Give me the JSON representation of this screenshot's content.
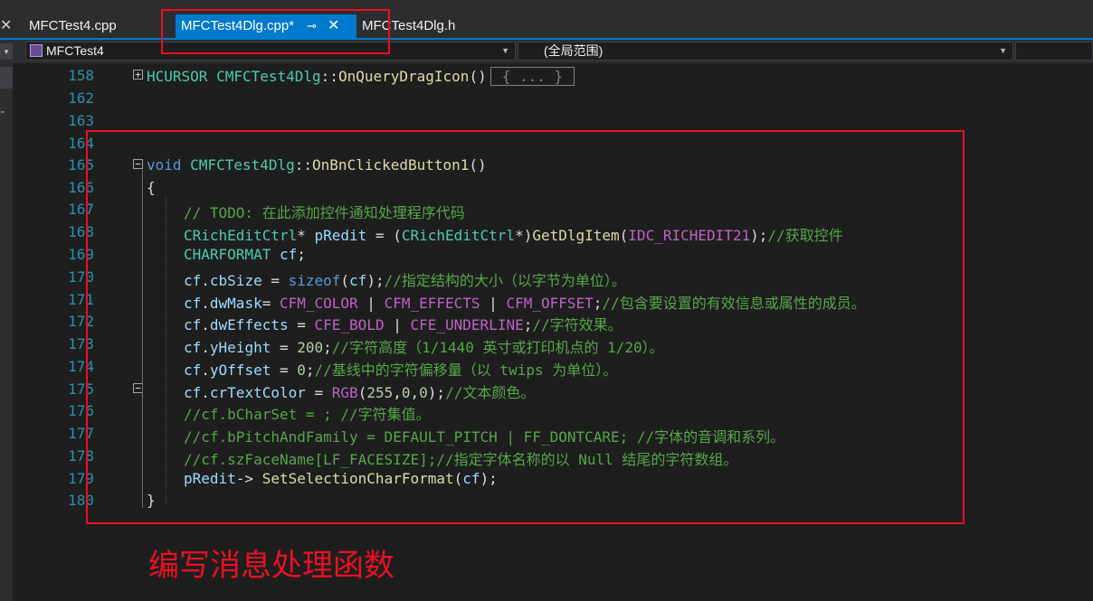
{
  "tabs": [
    {
      "label": "MFCTest4.cpp"
    },
    {
      "label": "MFCTest4Dlg.cpp*",
      "active": true
    },
    {
      "label": "MFCTest4Dlg.h"
    }
  ],
  "nav": {
    "project": "MFCTest4",
    "scope": "(全局范围)"
  },
  "lines": [
    {
      "no": "158",
      "text": "HCURSOR CMFCTest4Dlg::OnQueryDragIcon()",
      "collapsed": "{ ... }"
    },
    {
      "no": "162",
      "text": ""
    },
    {
      "no": "163",
      "text": ""
    },
    {
      "no": "164",
      "text": ""
    },
    {
      "no": "165",
      "text": "void CMFCTest4Dlg::OnBnClickedButton1()"
    },
    {
      "no": "166",
      "text": "{"
    },
    {
      "no": "167",
      "text": "// TODO: 在此添加控件通知处理程序代码"
    },
    {
      "no": "168",
      "text": "CRichEditCtrl* pRedit = (CRichEditCtrl*)GetDlgItem(IDC_RICHEDIT21);//获取控件"
    },
    {
      "no": "169",
      "text": "CHARFORMAT cf;"
    },
    {
      "no": "170",
      "text": "cf.cbSize = sizeof(cf);//指定结构的大小（以字节为单位）。"
    },
    {
      "no": "171",
      "text": "cf.dwMask= CFM_COLOR | CFM_EFFECTS | CFM_OFFSET;//包含要设置的有效信息或属性的成员。"
    },
    {
      "no": "172",
      "text": "cf.dwEffects = CFE_BOLD | CFE_UNDERLINE;//字符效果。"
    },
    {
      "no": "173",
      "text": "cf.yHeight = 200;//字符高度（1/1440 英寸或打印机点的 1/20）。"
    },
    {
      "no": "174",
      "text": "cf.yOffset = 0;//基线中的字符偏移量（以 twips 为单位）。"
    },
    {
      "no": "175",
      "text": "cf.crTextColor = RGB(255,0,0);//文本颜色。"
    },
    {
      "no": "176",
      "text": "//cf.bCharSet = ; //字符集值。"
    },
    {
      "no": "177",
      "text": "//cf.bPitchAndFamily = DEFAULT_PITCH | FF_DONTCARE; //字体的音调和系列。"
    },
    {
      "no": "178",
      "text": "//cf.szFaceName[LF_FACESIZE];//指定字体名称的以 Null 结尾的字符数组。"
    },
    {
      "no": "179",
      "text": "pRedit-> SetSelectionCharFormat(cf);"
    },
    {
      "no": "180",
      "text": "}"
    }
  ],
  "annotation": "编写消息处理函数",
  "colors": {
    "accent": "#007acc",
    "highlight": "#e81123",
    "editor_bg": "#1e1e1e"
  }
}
